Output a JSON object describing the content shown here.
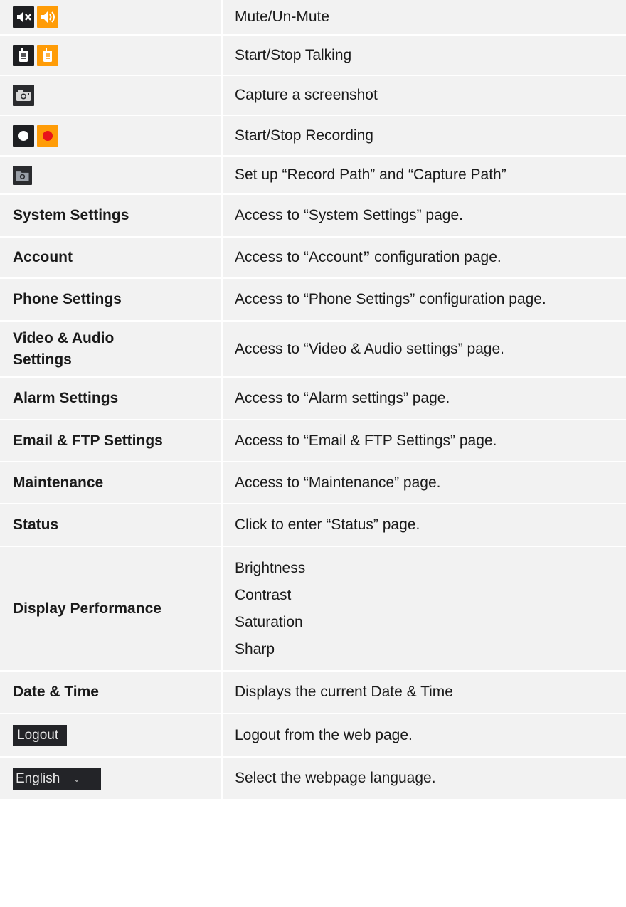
{
  "rows": [
    {
      "icons": [
        "mute-icon",
        "speaker-icon"
      ],
      "desc": "Mute/Un-Mute"
    },
    {
      "icons": [
        "talk-icon",
        "talk-active-icon"
      ],
      "desc": "Start/Stop Talking"
    },
    {
      "icons": [
        "camera-icon"
      ],
      "desc": "Capture a screenshot"
    },
    {
      "icons": [
        "record-icon",
        "record-active-icon"
      ],
      "desc": "Start/Stop Recording"
    },
    {
      "icons": [
        "folder-camera-icon"
      ],
      "desc": "Set up “Record Path” and “Capture Path”"
    },
    {
      "label": "System Settings",
      "desc": "Access to “System Settings” page."
    },
    {
      "label": "Account",
      "desc_parts": [
        "Access to “Account",
        "”",
        " configuration page."
      ]
    },
    {
      "label": "Phone Settings",
      "desc": "Access to “Phone Settings” configuration page."
    },
    {
      "label": "Video & Audio Settings",
      "label_lines": [
        "Video & Audio",
        "Settings"
      ],
      "desc": "Access to “Video & Audio settings” page."
    },
    {
      "label": "Alarm Settings",
      "desc": "Access to “Alarm settings” page."
    },
    {
      "label": "Email & FTP Settings",
      "desc": "Access to “Email & FTP Settings” page."
    },
    {
      "label": "Maintenance",
      "desc": "Access to “Maintenance” page."
    },
    {
      "label": "Status",
      "desc": "Click to enter “Status” page."
    },
    {
      "label": "Display Performance",
      "desc_list": [
        "Brightness",
        "Contrast",
        "Saturation",
        "Sharp"
      ]
    },
    {
      "label": "Date & Time",
      "desc": "Displays the current Date & Time"
    },
    {
      "button": "Logout",
      "desc": "Logout from the web page."
    },
    {
      "button": "English",
      "button_icon": "chevron-down-icon",
      "desc": "Select the webpage language."
    }
  ],
  "colors": {
    "cell_bg": "#f2f2f2",
    "icon_dark": "#1e1f22",
    "icon_active": "#ff9c07",
    "record_red": "#e8151b"
  }
}
